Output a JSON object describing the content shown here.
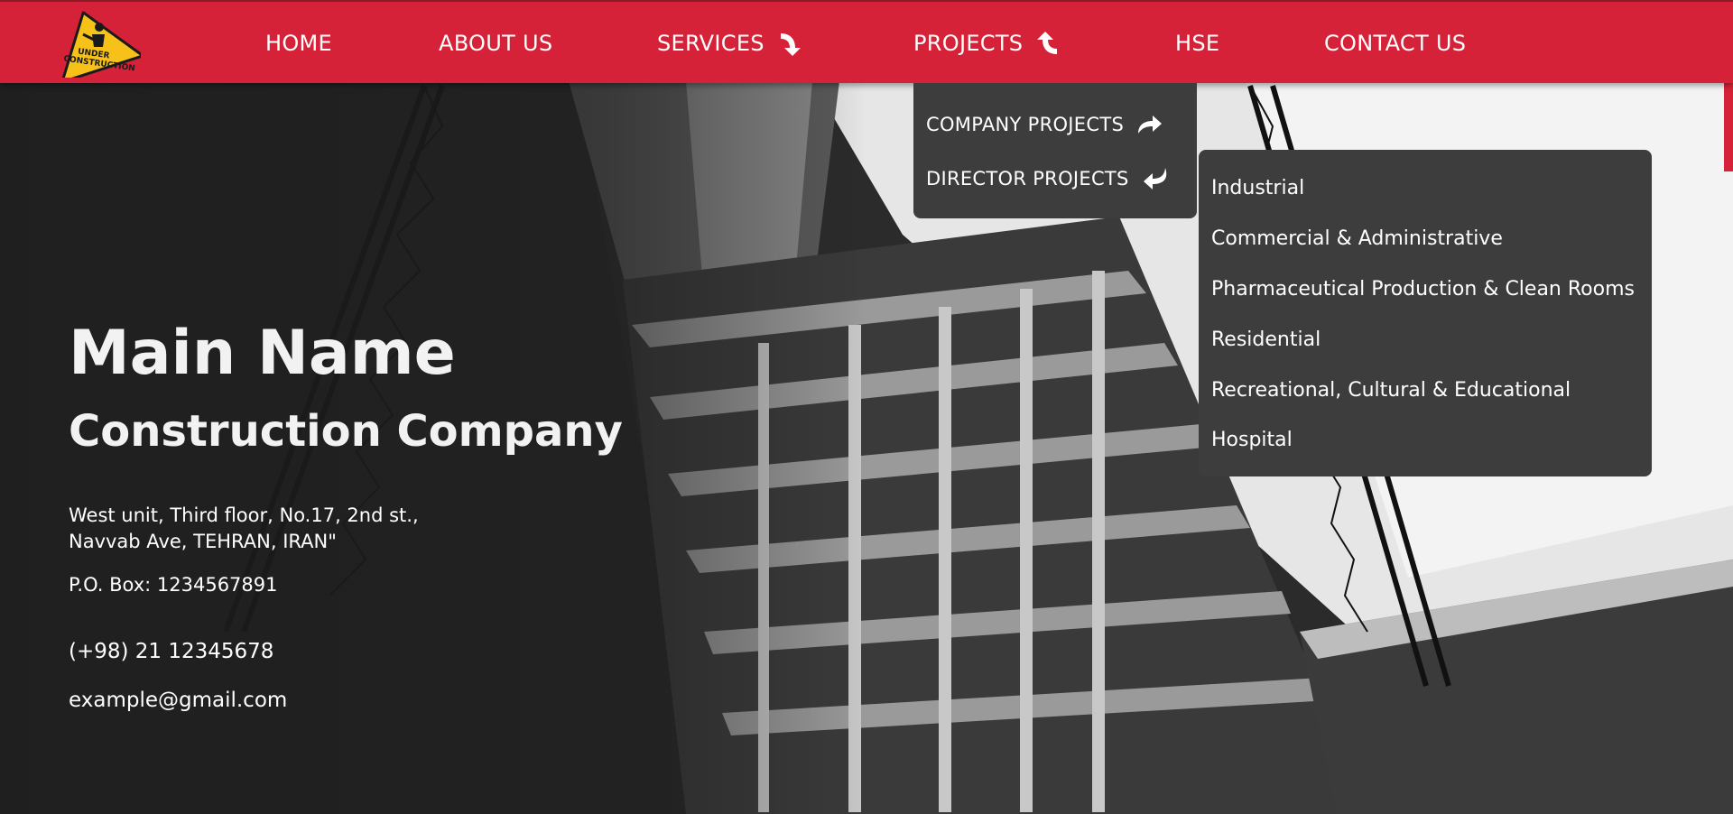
{
  "logo": {
    "line1": "UNDER",
    "line2": "CONSTRUCTION",
    "icon": "under-construction-sign-icon"
  },
  "nav": {
    "home": "HOME",
    "about": "ABOUT US",
    "services": "SERVICES",
    "projects": "PROJECTS",
    "hse": "HSE",
    "contact": "CONTACT US"
  },
  "projects_menu": {
    "company_projects": "COMPANY PROJECTS",
    "director_projects": "DIRECTOR PROJECTS"
  },
  "director_projects_menu": [
    "Industrial",
    "Commercial & Administrative",
    "Pharmaceutical Production & Clean Rooms",
    "Residential",
    "Recreational, Cultural & Educational",
    "Hospital"
  ],
  "hero": {
    "main_name": "Main Name",
    "company": "Construction Company",
    "address_line1": "West unit, Third floor, No.17, 2nd st.,",
    "address_line2": "Navvab Ave, TEHRAN, IRAN\"",
    "po_box": "P.O. Box: 1234567891",
    "phone": "(+98) 21 12345678",
    "email": "example@gmail.com"
  },
  "colors": {
    "header": "#d62238",
    "dropdown": "#3d3d3d",
    "text": "#ffffff"
  }
}
